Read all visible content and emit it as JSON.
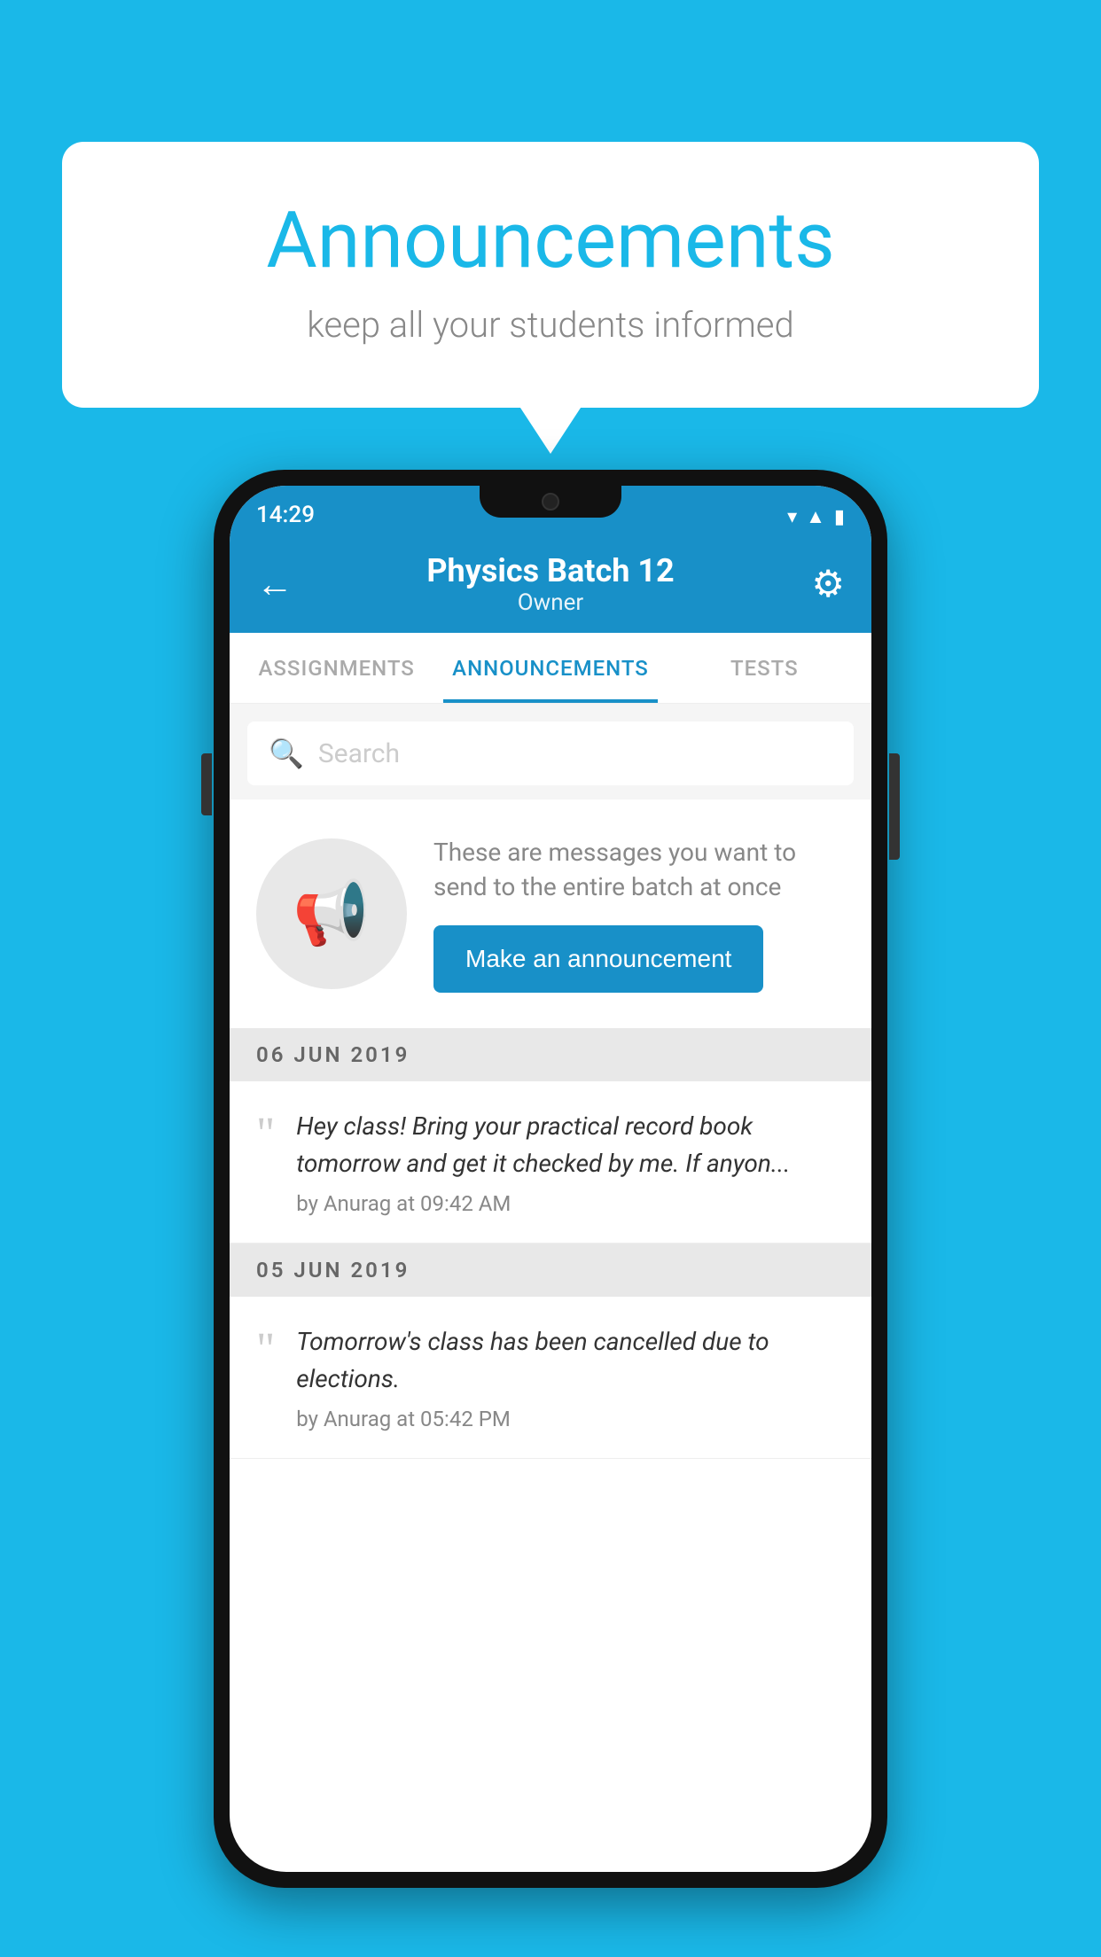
{
  "background_color": "#1ab8e8",
  "speech_bubble": {
    "title": "Announcements",
    "subtitle": "keep all your students informed"
  },
  "phone": {
    "status_bar": {
      "time": "14:29",
      "icons": [
        "wifi",
        "signal",
        "battery"
      ]
    },
    "app_bar": {
      "title": "Physics Batch 12",
      "subtitle": "Owner",
      "back_label": "←",
      "gear_label": "⚙"
    },
    "tabs": [
      {
        "label": "ASSIGNMENTS",
        "active": false
      },
      {
        "label": "ANNOUNCEMENTS",
        "active": true
      },
      {
        "label": "TESTS",
        "active": false
      },
      {
        "label": "...",
        "active": false
      }
    ],
    "search": {
      "placeholder": "Search"
    },
    "promo": {
      "description_text": "These are messages you want to send to the entire batch at once",
      "button_label": "Make an announcement"
    },
    "announcements": [
      {
        "date": "06  JUN  2019",
        "text": "Hey class! Bring your practical record book tomorrow and get it checked by me. If anyon...",
        "author": "by Anurag at 09:42 AM"
      },
      {
        "date": "05  JUN  2019",
        "text": "Tomorrow's class has been cancelled due to elections.",
        "author": "by Anurag at 05:42 PM"
      }
    ]
  }
}
